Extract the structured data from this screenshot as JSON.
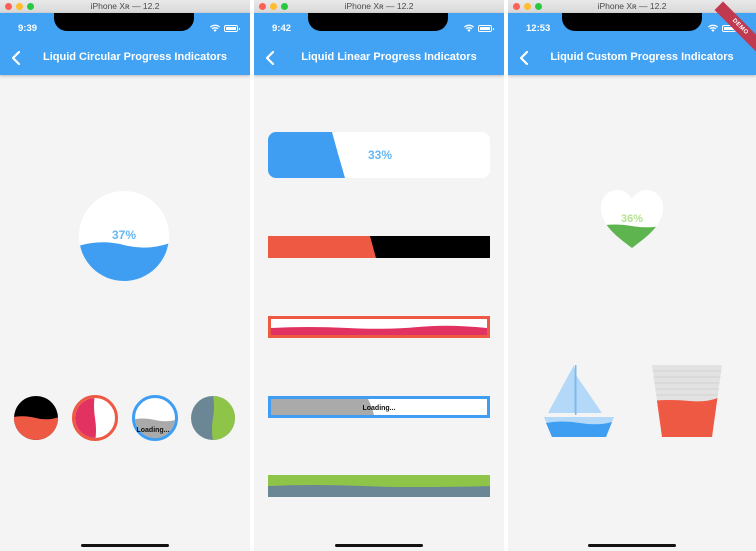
{
  "window_title": "iPhone Xʀ — 12.2",
  "colors": {
    "appbar": "#42a2f3",
    "blue": "#3f9ef2",
    "red": "#ee5944",
    "black": "#000000",
    "pink": "#e23261",
    "grey": "#aaaaaa",
    "slate": "#6b8796",
    "lime": "#8ec548",
    "green": "#5eb54f"
  },
  "screens": [
    {
      "time": "9:39",
      "title": "Liquid Circular Progress Indicators",
      "main_indicator": {
        "progress_label": "37%",
        "progress": 0.37
      },
      "small_indicators": [
        {
          "fill": "red",
          "background": "black",
          "progress": 0.5
        },
        {
          "fill": "pink",
          "background": "white",
          "border": "red",
          "progress": 0.5
        },
        {
          "fill": "grey",
          "background": "white",
          "border": "blue",
          "progress": 0.45,
          "label": "Loading..."
        },
        {
          "fill": "lime",
          "background": "slate",
          "progress": 0.5
        }
      ]
    },
    {
      "time": "9:42",
      "title": "Liquid Linear Progress Indicators",
      "bars": [
        {
          "fill": "blue",
          "background": "white",
          "progress": 0.33,
          "label": "33%"
        },
        {
          "fill": "red",
          "background": "black",
          "progress": 0.48
        },
        {
          "fill": "pink",
          "background": "white",
          "border": "red",
          "progress": 0.5
        },
        {
          "fill": "grey",
          "background": "white",
          "border": "blue",
          "progress": 0.45,
          "label": "Loading..."
        },
        {
          "fill": "slate",
          "background": "lime",
          "progress": 0.5
        }
      ]
    },
    {
      "time": "12:53",
      "title": "Liquid Custom Progress Indicators",
      "badge": "DEMO",
      "heart": {
        "progress_label": "36%",
        "progress": 0.36
      },
      "boat_icon": "sailboat-icon",
      "glass_icon": "glass-icon"
    }
  ]
}
